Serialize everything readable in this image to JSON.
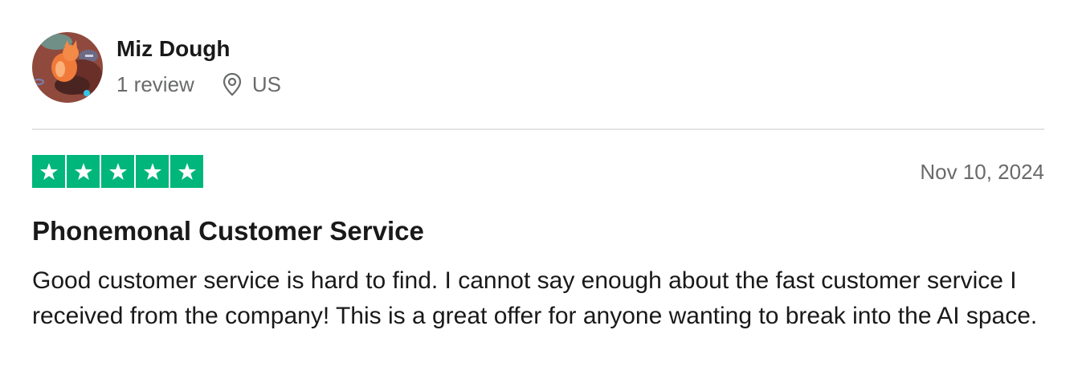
{
  "reviewer": {
    "name": "Miz Dough",
    "review_count": "1 review",
    "country": "US",
    "avatar_icon": "dog-avatar-icon",
    "location_icon": "location-pin-icon"
  },
  "rating": {
    "stars": 5,
    "max_stars": 5,
    "star_color": "#00b67a"
  },
  "review": {
    "date": "Nov 10, 2024",
    "title": "Phonemonal Customer Service",
    "body": "Good customer service is hard to find. I cannot say enough about the fast customer service I received from the company! This is a great offer for anyone wanting to break into the AI space."
  }
}
